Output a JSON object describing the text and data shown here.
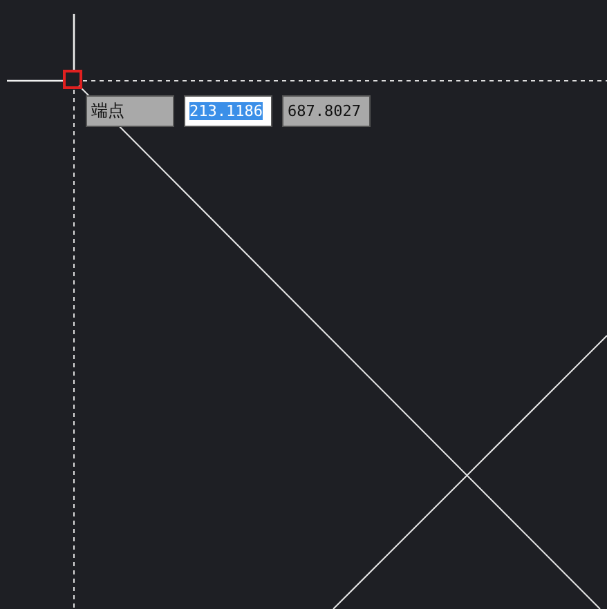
{
  "snap_tooltip": {
    "label": "端点"
  },
  "coordinate_fields": [
    {
      "value": "213.1186",
      "selected": true
    },
    {
      "value": "687.8027",
      "selected": false
    }
  ]
}
